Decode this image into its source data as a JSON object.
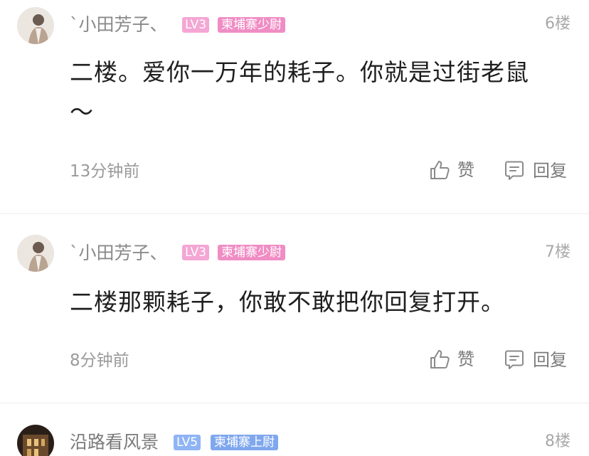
{
  "posts": [
    {
      "username": "`小田芳子、",
      "level": "LV3",
      "rank": "柬埔寨少尉",
      "floor": "6楼",
      "content_line1": "二楼。爱你一万年的耗子。你就是过街老鼠",
      "content_line2": "～",
      "time": "13分钟前",
      "like_label": "赞",
      "reply_label": "回复"
    },
    {
      "username": "`小田芳子、",
      "level": "LV3",
      "rank": "柬埔寨少尉",
      "floor": "7楼",
      "content_line1": "二楼那颗耗子，你敢不敢把你回复打开。",
      "time": "8分钟前",
      "like_label": "赞",
      "reply_label": "回复"
    },
    {
      "username": "沿路看风景",
      "level": "LV5",
      "rank": "柬埔寨上尉",
      "floor": "8楼"
    }
  ],
  "colors": {
    "lv3_badge": "#f4a6d4",
    "lv3_rank": "#f08dc4",
    "lv5_badge": "#8fb4f4",
    "lv5_rank": "#7fa7ee",
    "text_primary": "#1e1e1e",
    "text_secondary": "#8a8a8a"
  },
  "icons": [
    "thumbs-up-icon",
    "comment-icon"
  ]
}
